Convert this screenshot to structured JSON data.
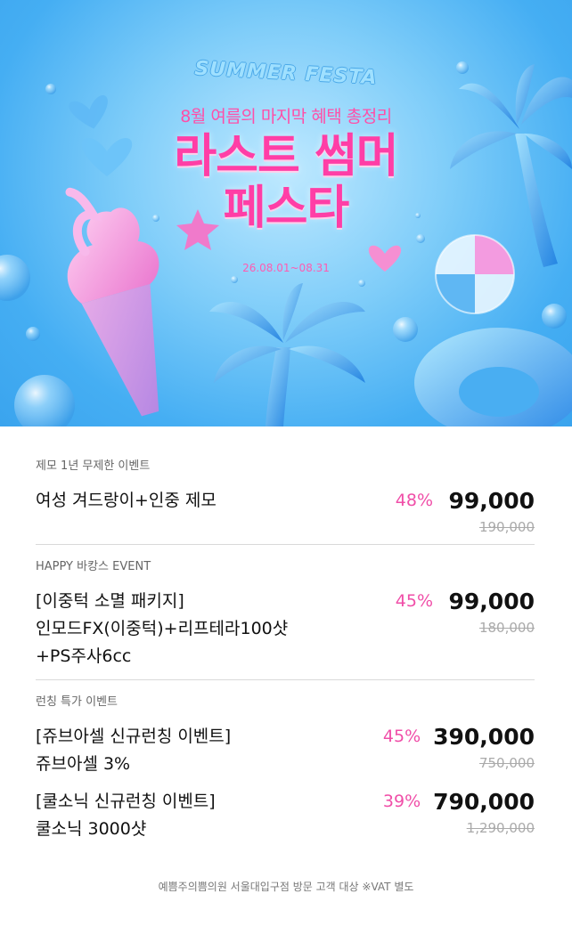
{
  "banner": {
    "logo_text": "SUMMER FESTA",
    "subtitle": "8월 여름의 마지막 혜택 총정리",
    "title_line1": "라스트 썸머",
    "title_line2": "페스타",
    "date": "26.08.01~08.31"
  },
  "sections": [
    {
      "label": "제모 1년 무제한 이벤트",
      "items": [
        {
          "name_lines": [
            "여성 겨드랑이+인중 제모"
          ],
          "discount": "48%",
          "price": "99,000",
          "original": "190,000"
        }
      ]
    },
    {
      "label": "HAPPY 바캉스 EVENT",
      "items": [
        {
          "name_lines": [
            "[이중턱 소멸 패키지]",
            "인모드FX(이중턱)+리프테라100샷",
            "+PS주사6cc"
          ],
          "discount": "45%",
          "price": "99,000",
          "original": "180,000"
        }
      ]
    },
    {
      "label": "런칭 특가 이벤트",
      "items": [
        {
          "name_lines": [
            "[쥬브아셀 신규런칭 이벤트]",
            "쥬브아셀 3%"
          ],
          "discount": "45%",
          "price": "390,000",
          "original": "750,000"
        },
        {
          "name_lines": [
            "[쿨소닉 신규런칭 이벤트]",
            "쿨소닉 3000샷"
          ],
          "discount": "39%",
          "price": "790,000",
          "original": "1,290,000"
        }
      ]
    }
  ],
  "footer": "예쁨주의쁨의원 서울대입구점 방문 고객 대상 ※VAT 별도",
  "colors": {
    "accent_pink": "#f04ea8",
    "sky": "#45aef3"
  }
}
